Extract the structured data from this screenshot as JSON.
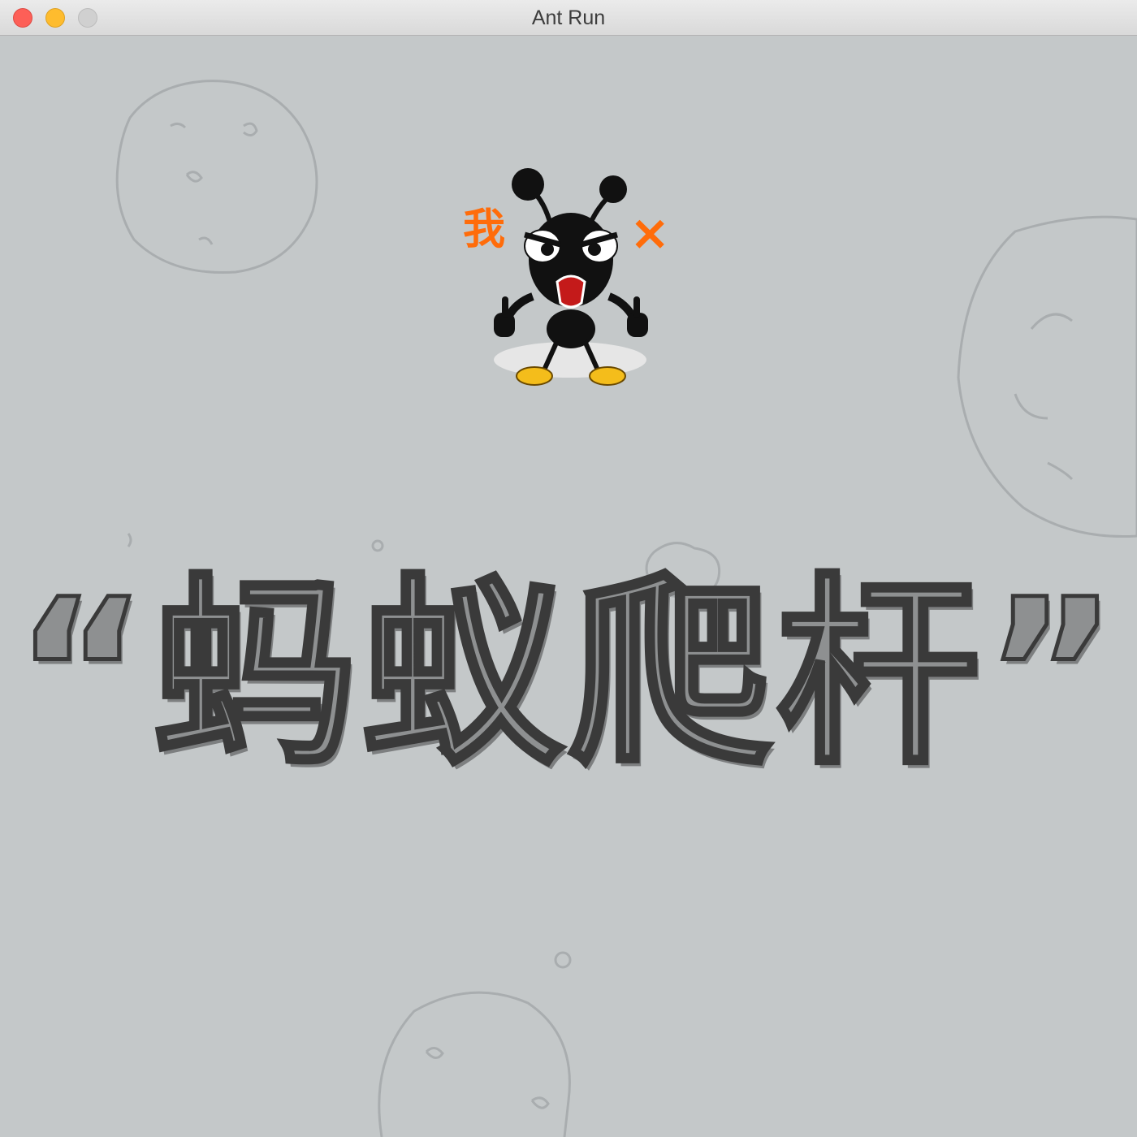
{
  "window": {
    "title": "Ant Run",
    "controls": [
      "close",
      "minimize",
      "zoom"
    ]
  },
  "game": {
    "title_text": "“蚂蚁爬杆”",
    "side_left": "我",
    "side_right": "×"
  },
  "colors": {
    "background": "#c4c8c9",
    "accent": "#ff6c0a",
    "title_fill": "#8e9091"
  }
}
